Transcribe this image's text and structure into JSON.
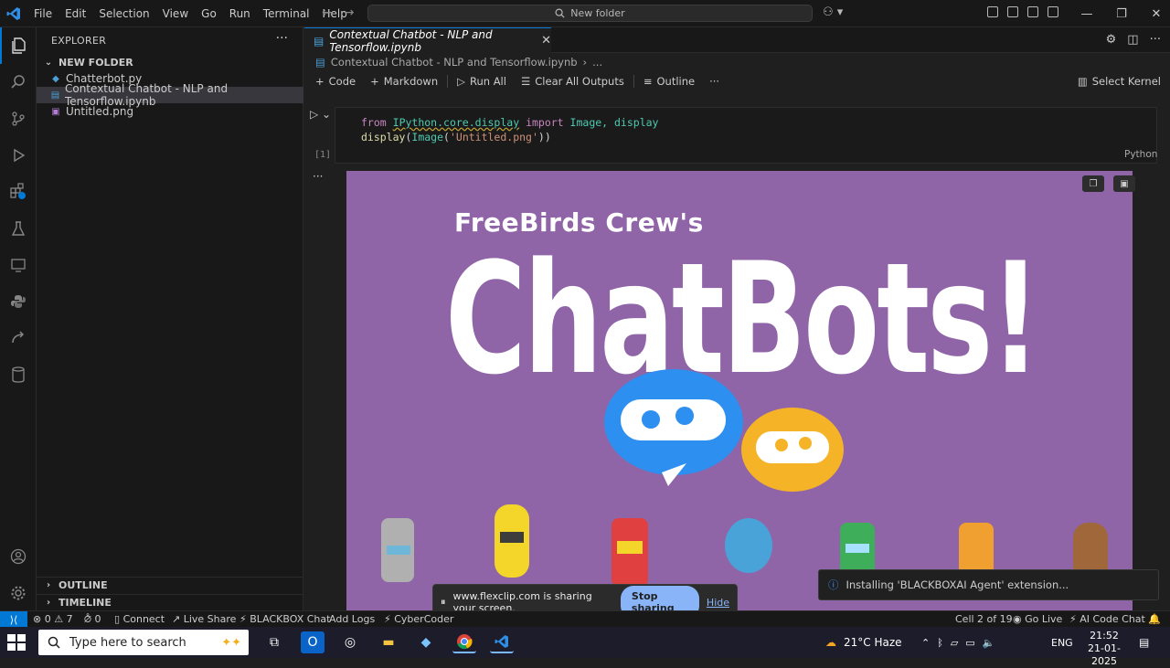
{
  "titlebar": {
    "menu": [
      "File",
      "Edit",
      "Selection",
      "View",
      "Go",
      "Run",
      "Terminal",
      "Help"
    ],
    "search_text": "New folder"
  },
  "sidebar": {
    "title": "EXPLORER",
    "folder": "NEW FOLDER",
    "files": [
      {
        "name": "Chatterbot.py"
      },
      {
        "name": "Contextual Chatbot - NLP and Tensorflow.ipynb"
      },
      {
        "name": "Untitled.png"
      }
    ],
    "outline": "OUTLINE",
    "timeline": "TIMELINE"
  },
  "editor": {
    "tab_title": "Contextual Chatbot - NLP and Tensorflow.ipynb",
    "breadcrumb": "Contextual Chatbot - NLP and Tensorflow.ipynb",
    "breadcrumb_tail": "...",
    "toolbar": {
      "code": "Code",
      "markdown": "Markdown",
      "run_all": "Run All",
      "clear_outputs": "Clear All Outputs",
      "outline": "Outline",
      "select_kernel": "Select Kernel"
    },
    "cell": {
      "exec_count": "[1]",
      "language": "Python",
      "line1": {
        "kw1": "from",
        "mod": "IPython.core.display",
        "kw2": "import",
        "names": "Image, display"
      },
      "line2": {
        "fn": "display",
        "p1": "(",
        "cls": "Image",
        "p2": "(",
        "str": "'Untitled.png'",
        "p3": "))"
      }
    },
    "output": {
      "crew": "FreeBirds Crew's",
      "headline": "ChatBots!"
    }
  },
  "notifications": {
    "share_text": "www.flexclip.com is sharing your screen.",
    "stop": "Stop sharing",
    "hide": "Hide",
    "toast": "Installing 'BLACKBOXAI Agent' extension..."
  },
  "statusbar": {
    "errors": "0",
    "warnings": "7",
    "ports": "0",
    "connect": "Connect",
    "liveshare": "Live Share",
    "blackbox": "BLACKBOX Chat",
    "addlogs": "Add Logs",
    "cybercoder": "CyberCoder",
    "cell_position": "Cell 2 of 19",
    "golive": "Go Live",
    "aichat": "AI Code Chat"
  },
  "taskbar": {
    "search_placeholder": "Type here to search",
    "weather": "21°C Haze",
    "lang": "ENG",
    "time": "21:52",
    "date": "21-01-2025"
  },
  "colors": {
    "accent": "#0078d4",
    "image_bg": "#8f65a8"
  }
}
